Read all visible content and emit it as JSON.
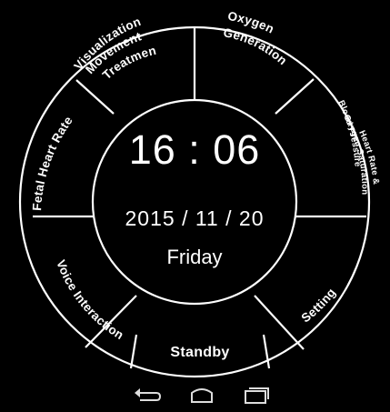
{
  "watch": {
    "time": "16 : 06",
    "date": "2015 / 11 / 20",
    "day": "Friday"
  },
  "menu": {
    "top_left_line1": "Visualization",
    "top_left_line2": "Movement",
    "top_left_line3": "Treatment",
    "top_right_line1": "Oxygen",
    "top_right_line2": "Generation",
    "right_line1": "Heart Rate &",
    "right_line2": "Oxygen Saturation",
    "right_line3": "Blood Pressure",
    "left": "Fetal Heart Rate",
    "bottom_left": "Voice Interaction",
    "bottom_right": "Setting",
    "standby": "Standby"
  },
  "navbar": {
    "back_icon": "back-arrow-icon",
    "home_icon": "home-icon",
    "recents_icon": "recent-apps-icon"
  },
  "colors": {
    "background": "#000000",
    "foreground": "#ffffff"
  }
}
